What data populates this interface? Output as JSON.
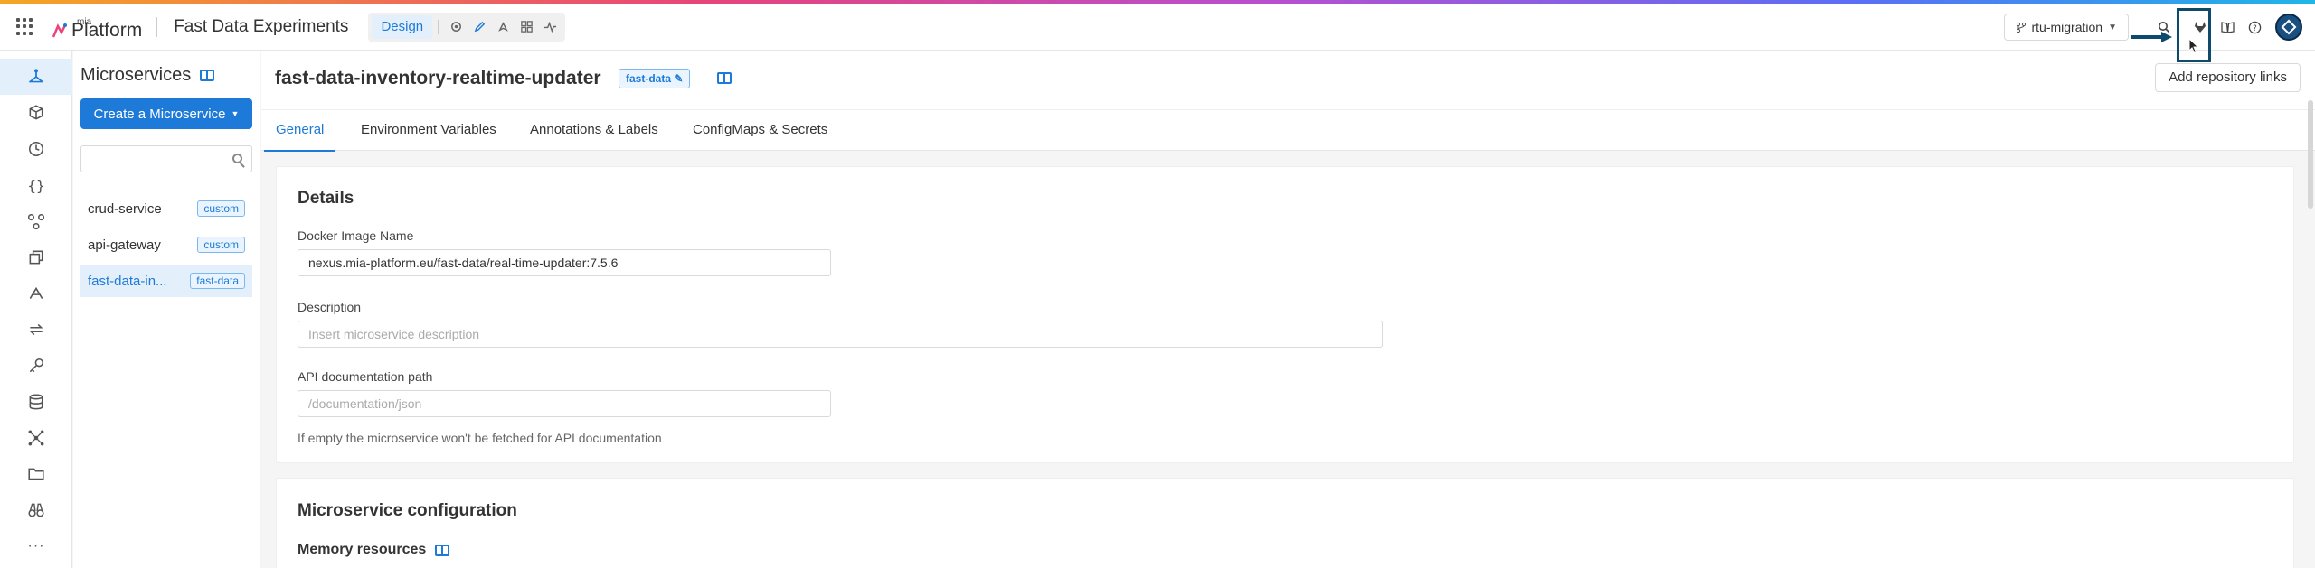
{
  "app": {
    "logo_prefix": "mia",
    "logo_text": "Platform",
    "project_title": "Fast Data Experiments",
    "mode_label": "Design",
    "branch": "rtu-migration"
  },
  "sidebar": {
    "items": [
      {
        "name": "design-icon",
        "active": true
      },
      {
        "name": "cube-icon"
      },
      {
        "name": "history-icon"
      },
      {
        "name": "braces-icon"
      },
      {
        "name": "nodes-icon"
      },
      {
        "name": "copy-icon"
      },
      {
        "name": "deploy-icon"
      },
      {
        "name": "sync-icon"
      },
      {
        "name": "key-icon"
      },
      {
        "name": "database-icon"
      },
      {
        "name": "network-icon"
      },
      {
        "name": "folder-icon"
      },
      {
        "name": "binoculars-icon"
      },
      {
        "name": "more-icon"
      }
    ]
  },
  "list": {
    "title": "Microservices",
    "create_label": "Create a Microservice",
    "search_placeholder": "",
    "items": [
      {
        "label": "crud-service",
        "tag": "custom"
      },
      {
        "label": "api-gateway",
        "tag": "custom"
      },
      {
        "label": "fast-data-in...",
        "tag": "fast-data"
      }
    ]
  },
  "detail": {
    "title": "fast-data-inventory-realtime-updater",
    "tag": "fast-data",
    "repo_button": "Add repository links",
    "tabs": [
      "General",
      "Environment Variables",
      "Annotations & Labels",
      "ConfigMaps & Secrets"
    ],
    "details": {
      "heading": "Details",
      "docker_label": "Docker Image Name",
      "docker_value": "nexus.mia-platform.eu/fast-data/real-time-updater:7.5.6",
      "description_label": "Description",
      "description_placeholder": "Insert microservice description",
      "api_label": "API documentation path",
      "api_placeholder": "/documentation/json",
      "api_help": "If empty the microservice won't be fetched for API documentation"
    },
    "config": {
      "heading": "Microservice configuration",
      "memory_label": "Memory resources"
    }
  },
  "colors": {
    "accent": "#1d7ad8",
    "highlight": "#0d4a6b"
  }
}
